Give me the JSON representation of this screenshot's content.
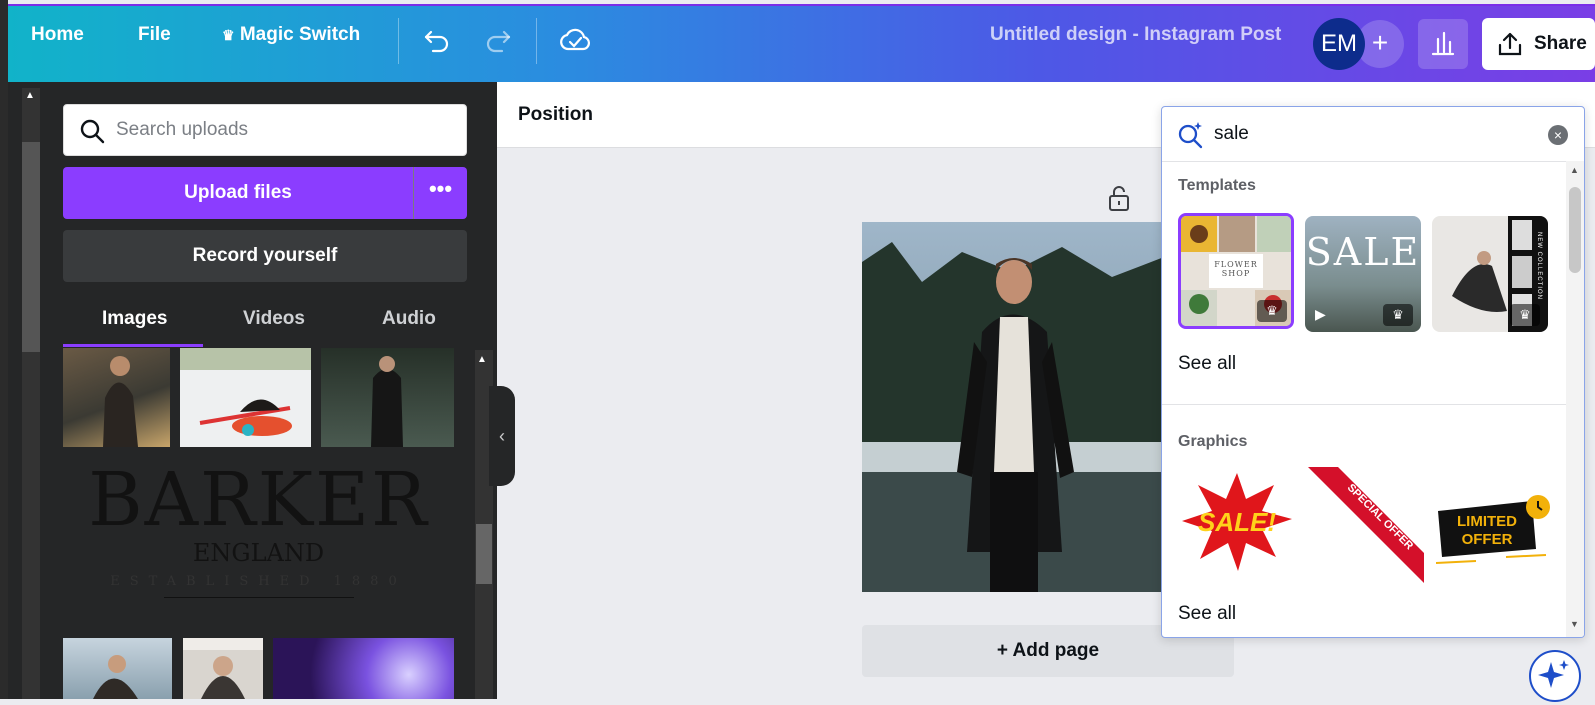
{
  "topbar": {
    "home": "Home",
    "file": "File",
    "magic_switch": "Magic Switch",
    "design_title": "Untitled design - Instagram Post",
    "avatar_initials": "EM",
    "add_member": "+",
    "share": "Share"
  },
  "side_panel": {
    "search_placeholder": "Search uploads",
    "upload_label": "Upload files",
    "more_label": "•••",
    "record_label": "Record yourself",
    "tabs": [
      "Images",
      "Videos",
      "Audio"
    ],
    "active_tab": "Images",
    "logo_text": {
      "main": "BARKER",
      "sub": "ENGLAND",
      "tag": "ESTABLISHED 1880"
    }
  },
  "editor": {
    "toolbar_label": "Position",
    "add_page": "+ Add page"
  },
  "search_popup": {
    "query": "sale",
    "templates_heading": "Templates",
    "template_items": [
      {
        "caption": "FLOWER SHOP",
        "premium": true
      },
      {
        "caption": "SALE",
        "premium": true,
        "video": true
      },
      {
        "caption": "NEW COLLECTION",
        "premium": true
      }
    ],
    "see_all_1": "See all",
    "graphics_heading": "Graphics",
    "graphic_items": [
      "SALE!",
      "SPECIAL OFFER",
      "LIMITED OFFER"
    ],
    "see_all_2": "See all"
  },
  "colors": {
    "accent": "#8b3dff",
    "panel_bg": "#252627",
    "canvas_bg": "#ebecf0"
  }
}
